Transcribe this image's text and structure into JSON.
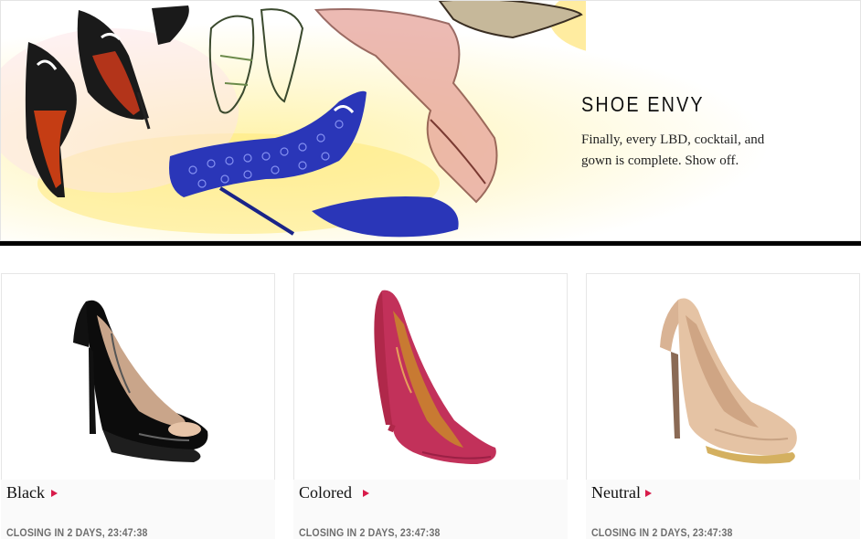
{
  "hero": {
    "title": "SHOE ENVY",
    "tagline_line1": "Finally, every LBD, cocktail, and",
    "tagline_line2": "gown is complete. Show off."
  },
  "products": [
    {
      "label": "Black",
      "closing": "CLOSING IN 2 DAYS, 23:47:38",
      "icon": "black-peep-toe-pump-image"
    },
    {
      "label": "Colored",
      "closing": "CLOSING IN 2 DAYS, 23:47:38",
      "icon": "red-suede-pump-image"
    },
    {
      "label": "Neutral",
      "closing": "CLOSING IN 2 DAYS, 23:47:38",
      "icon": "nude-platform-pump-image"
    }
  ],
  "colors": {
    "accent_arrow": "#d81b4a",
    "divider": "#000000",
    "closing_text": "#6f6f6f"
  }
}
